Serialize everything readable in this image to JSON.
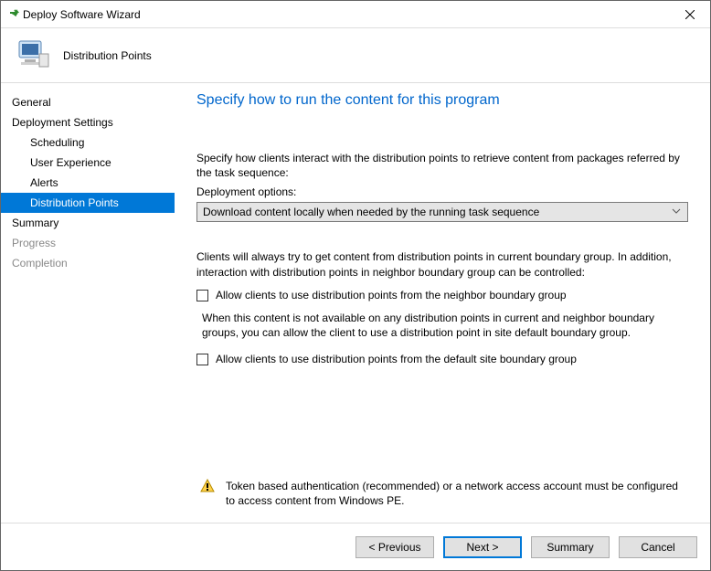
{
  "window": {
    "title": "Deploy Software Wizard"
  },
  "header": {
    "title": "Distribution Points"
  },
  "sidebar": {
    "items": [
      {
        "label": "General",
        "indent": 0,
        "state": "normal"
      },
      {
        "label": "Deployment Settings",
        "indent": 0,
        "state": "normal"
      },
      {
        "label": "Scheduling",
        "indent": 1,
        "state": "normal"
      },
      {
        "label": "User Experience",
        "indent": 1,
        "state": "normal"
      },
      {
        "label": "Alerts",
        "indent": 1,
        "state": "normal"
      },
      {
        "label": "Distribution Points",
        "indent": 1,
        "state": "selected"
      },
      {
        "label": "Summary",
        "indent": 0,
        "state": "normal"
      },
      {
        "label": "Progress",
        "indent": 0,
        "state": "disabled"
      },
      {
        "label": "Completion",
        "indent": 0,
        "state": "disabled"
      }
    ]
  },
  "page": {
    "title": "Specify how to run the content for this program",
    "intro": "Specify how clients interact with the distribution points to retrieve content from packages referred by the task sequence:",
    "deploy_label": "Deployment options:",
    "deploy_value": "Download content locally when needed by the running task sequence",
    "boundary_text": "Clients will always try to get content from distribution points in current boundary group. In addition, interaction with distribution points in neighbor boundary group can be controlled:",
    "chk_neighbor": "Allow clients to use distribution points from the neighbor boundary group",
    "fallback_text": "When this content is not available on any distribution points in current and neighbor boundary groups, you can allow the client to use a distribution point in site default boundary group.",
    "chk_default": "Allow clients to use distribution points from the default site boundary group",
    "warn": "Token based authentication (recommended) or a network access account must be configured to access content from Windows PE."
  },
  "footer": {
    "previous": "< Previous",
    "next": "Next >",
    "summary": "Summary",
    "cancel": "Cancel"
  }
}
